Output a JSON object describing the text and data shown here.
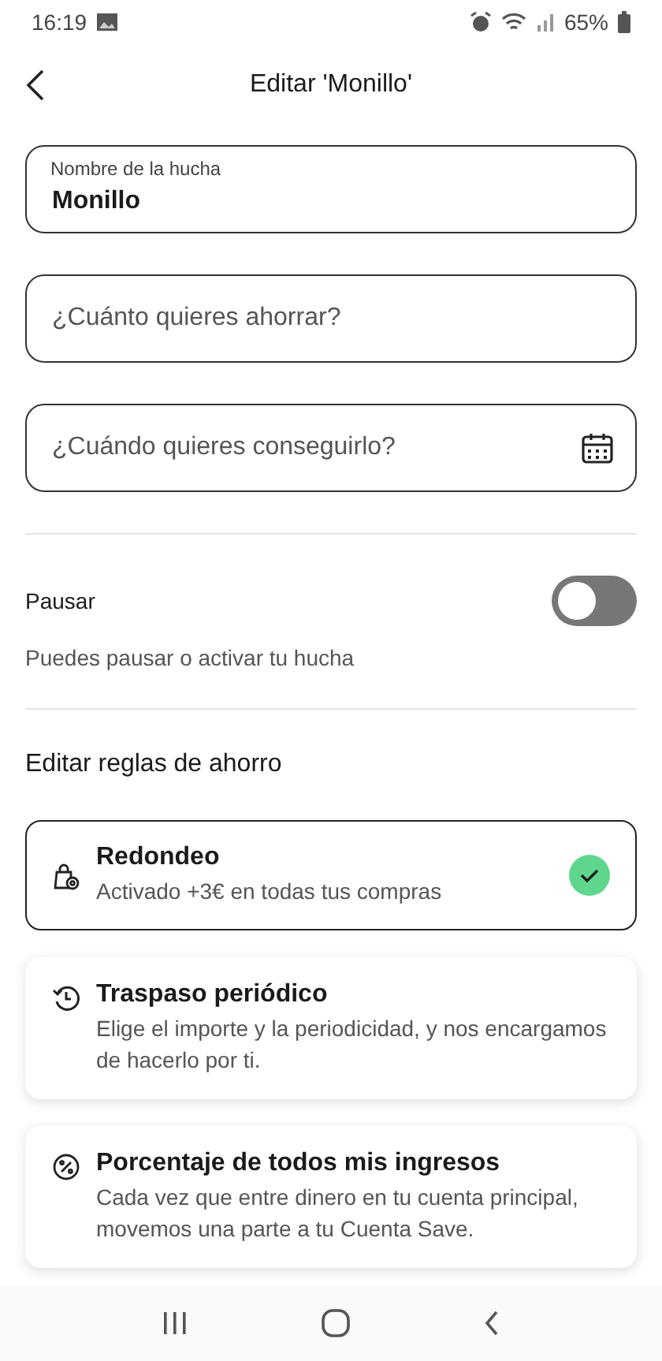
{
  "status_bar": {
    "time": "16:19",
    "battery": "65%"
  },
  "header": {
    "title": "Editar 'Monillo'"
  },
  "fields": [
    {
      "label": "Nombre de la hucha",
      "value": "Monillo",
      "kind": "text"
    },
    {
      "placeholder": "¿Cuánto quieres ahorrar?",
      "kind": "text"
    },
    {
      "placeholder": "¿Cuándo quieres conseguirlo?",
      "kind": "date"
    }
  ],
  "pause": {
    "label": "Pausar",
    "on": false,
    "description": "Puedes pausar o activar tu hucha"
  },
  "rules_title": "Editar reglas de ahorro",
  "rules": [
    {
      "kind": "roundup",
      "title": "Redondeo",
      "description": "Activado +3€ en todas tus compras",
      "selected": true
    },
    {
      "kind": "transfer",
      "title": "Traspaso periódico",
      "description": "Elige el importe y la periodicidad, y nos encargamos de hacerlo por ti.",
      "selected": false
    },
    {
      "kind": "percentage",
      "title": "Porcentaje de todos mis ingresos",
      "description": "Cada vez que entre dinero en tu cuenta principal, movemos una parte a tu Cuenta Save.",
      "selected": false
    }
  ]
}
